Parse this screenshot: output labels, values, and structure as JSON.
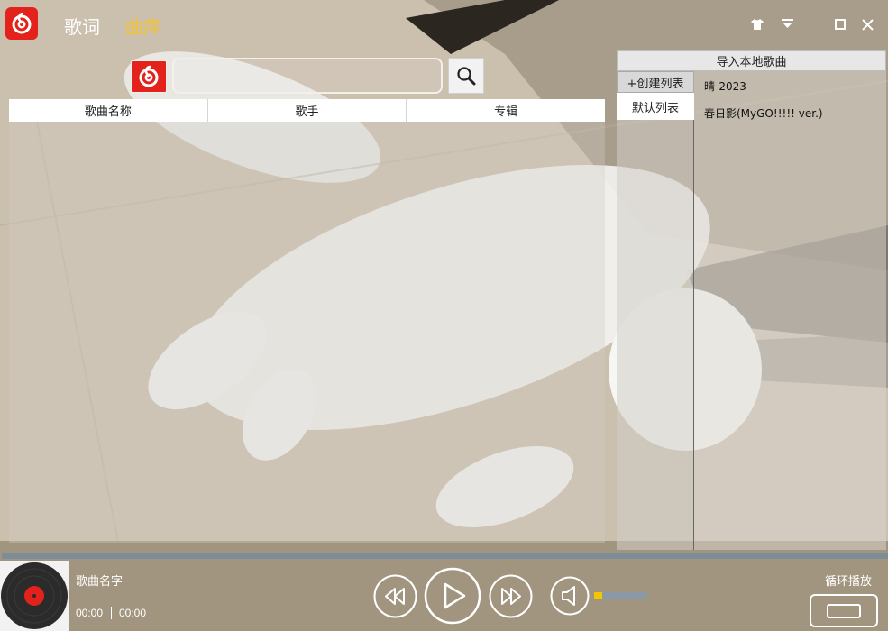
{
  "top_tabs": {
    "lyrics": "歌词",
    "library": "曲库"
  },
  "colors": {
    "brand_red": "#e2221b",
    "active_tab": "#f1c232",
    "inactive_tab": "#ffffff",
    "progress_track": "#7c8c99",
    "volume_fill": "#f5c500"
  },
  "search": {
    "value": "",
    "placeholder": ""
  },
  "table": {
    "columns": [
      "歌曲名称",
      "歌手",
      "专辑"
    ],
    "rows": []
  },
  "right_panel": {
    "import_label": "导入本地歌曲",
    "create_playlist_label": "+创建列表",
    "playlists": [
      "默认列表"
    ],
    "local_songs": [
      "晴-2023",
      "春日影(MyGO!!!!! ver.)"
    ]
  },
  "player": {
    "song_title": "歌曲名字",
    "current_time": "00:00",
    "total_time": "00:00",
    "progress": 0,
    "volume": 0.15,
    "play_mode": "循环播放"
  },
  "icons": [
    "netease-logo-icon",
    "shirt-icon",
    "dropdown-menu-icon",
    "maximize-icon",
    "close-icon",
    "search-icon",
    "rewind-icon",
    "play-icon",
    "fast-forward-icon",
    "volume-icon",
    "vinyl-record-icon",
    "loop-mode-icon"
  ]
}
